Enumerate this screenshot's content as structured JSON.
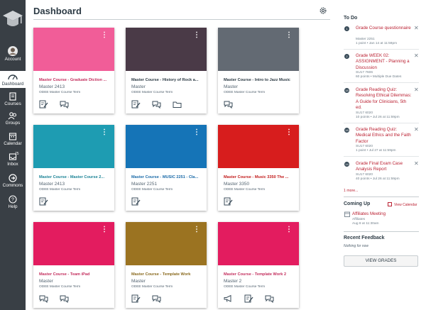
{
  "nav": {
    "items": [
      {
        "key": "account",
        "label": "Account",
        "icon": "account-avatar-icon"
      },
      {
        "key": "dashboard",
        "label": "Dashboard",
        "icon": "dashboard-icon"
      },
      {
        "key": "courses",
        "label": "Courses",
        "icon": "courses-icon"
      },
      {
        "key": "groups",
        "label": "Groups",
        "icon": "groups-icon"
      },
      {
        "key": "calendar",
        "label": "Calendar",
        "icon": "calendar-icon"
      },
      {
        "key": "inbox",
        "label": "Inbox",
        "icon": "inbox-icon",
        "badge": "75"
      },
      {
        "key": "commons",
        "label": "Commons",
        "icon": "commons-icon"
      },
      {
        "key": "help",
        "label": "Help",
        "icon": "help-icon"
      }
    ]
  },
  "header": {
    "title": "Dashboard",
    "options_icon": "gear-icon"
  },
  "cards": [
    {
      "title": "Master Course - Graduate Diction ...",
      "code": "Master 2413",
      "term": "ODEE Master Course Term",
      "color": "#f15d98",
      "title_color": "#c4305f",
      "icons": [
        "assignments-icon",
        "discussions-icon"
      ]
    },
    {
      "title": "Master Course - History of Rock a...",
      "code": "Master",
      "term": "ODEE Master Course Term",
      "color": "#4a3a47",
      "title_color": "#2d3b45",
      "icons": [
        "assignments-icon",
        "discussions-icon",
        "files-icon"
      ]
    },
    {
      "title": "Master Course - Intro to Jazz Music",
      "code": "Master",
      "term": "ODEE Master Course Term",
      "color": "#636a73",
      "title_color": "#2d3b45",
      "icons": [
        "discussions-icon"
      ]
    },
    {
      "title": "Master Course - Master Course 2...",
      "code": "Master 2413",
      "term": "ODEE Master Course Term",
      "color": "#1e9cb2",
      "title_color": "#1b8396",
      "icons": [
        "assignments-icon"
      ]
    },
    {
      "title": "Master Course - MUSIC 2251 - Cla...",
      "code": "Master 2251",
      "term": "ODEE Master Course Term",
      "color": "#1574b7",
      "title_color": "#1a6aa8",
      "icons": [
        "assignments-icon"
      ]
    },
    {
      "title": "Master Course - Music 3350 The ...",
      "code": "Master 3350",
      "term": "ODEE Master Course Term",
      "color": "#d71d1d",
      "title_color": "#c21b1b",
      "icons": [
        "assignments-icon"
      ]
    },
    {
      "title": "Master Course - Team iPad",
      "code": "Master",
      "term": "ODEE Master Course Term",
      "color": "#e31c5f",
      "title_color": "#c4305f",
      "icons": [
        "discussions-icon",
        "discussions-icon"
      ]
    },
    {
      "title": "Master Course - Template Work",
      "code": "Master",
      "term": "ODEE Master Course Term",
      "color": "#9b7321",
      "title_color": "#8a6a1e",
      "icons": [
        "assignments-icon",
        "discussions-icon"
      ]
    },
    {
      "title": "Master Course - Template Work 2",
      "code": "Master 2",
      "term": "ODEE Master Course Term",
      "color": "#e31c5f",
      "title_color": "#c4305f",
      "icons": [
        "announcements-icon",
        "assignments-icon",
        "discussions-icon"
      ]
    }
  ],
  "todo": {
    "heading": "To Do",
    "items": [
      {
        "num": "1",
        "title": "Grade Course questionnaire",
        "course": "Master 2251",
        "meta": "1 point • Jan 14 at 11:59pm"
      },
      {
        "num": "2",
        "title": "Grade WEEK 02: ASSIGNMENT - Planning a Discussion",
        "course": "SU17 7606",
        "meta": "60 points • Multiple Due Dates"
      },
      {
        "num": "18",
        "title": "Grade Reading Quiz: Resolving Ethical Dilemmas: A Guide for Clinicians, 5th ed.",
        "course": "SU17 6020",
        "meta": "10 points • Jul 26 at 11:59pm"
      },
      {
        "num": "18",
        "title": "Grade Reading Quiz: Medical Ethics and the Faith Factor",
        "course": "SU17 6020",
        "meta": "1 point • Jul 27 at 11:59pm"
      },
      {
        "num": "14",
        "title": "Grade Final Exam Case Analysis Report",
        "course": "SU17 6020",
        "meta": "40 points • Jul 26 at 11:59pm"
      }
    ],
    "more": "1 more..."
  },
  "coming_up": {
    "heading": "Coming Up",
    "view_calendar": "View Calendar",
    "event": {
      "title": "Affiliates Meeting",
      "course": "Affiliates",
      "date": "Aug 8 at 11:30am"
    }
  },
  "recent_feedback": {
    "heading": "Recent Feedback",
    "empty": "Nothing for now"
  },
  "view_grades": "VIEW GRADES"
}
